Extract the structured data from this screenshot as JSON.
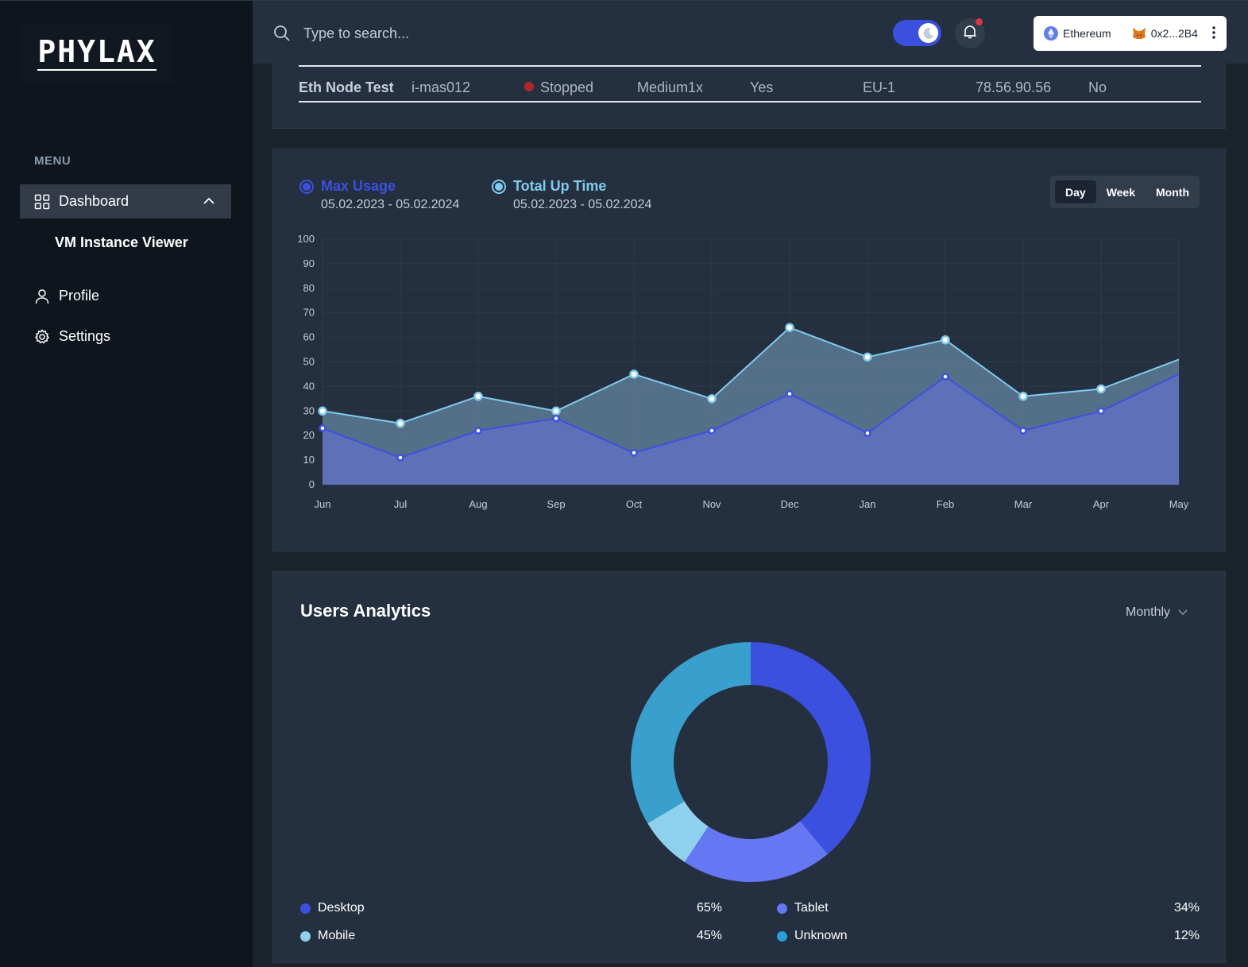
{
  "brand": {
    "logo_text": "PHYLAX"
  },
  "sidebar": {
    "menu_title": "MENU",
    "dashboard_label": "Dashboard",
    "sub_item_label": "VM Instance Viewer",
    "profile_label": "Profile",
    "settings_label": "Settings"
  },
  "header": {
    "search_placeholder": "Type to search...",
    "dark_mode_on": true,
    "network_label": "Ethereum",
    "account_label": "0x2...2B4"
  },
  "table_row": {
    "name": "Eth Node Test",
    "instance_id": "i-mas012",
    "status": "Stopped",
    "size": "Medium1x",
    "public": "Yes",
    "region": "EU-1",
    "ip": "78.56.90.56",
    "last": "No"
  },
  "usage_chart": {
    "series_a_label": "Max Usage",
    "series_a_dates": "05.02.2023 - 05.02.2024",
    "series_b_label": "Total Up Time",
    "series_b_dates": "05.02.2023 - 05.02.2024",
    "periods": [
      "Day",
      "Week",
      "Month"
    ],
    "active_period": "Day"
  },
  "chart_data": [
    {
      "type": "area",
      "categories": [
        "Jun",
        "Jul",
        "Aug",
        "Sep",
        "Oct",
        "Nov",
        "Dec",
        "Jan",
        "Feb",
        "Mar",
        "Apr",
        "May"
      ],
      "series": [
        {
          "name": "Max Usage",
          "color": "#3C50E0",
          "values": [
            23,
            11,
            22,
            27,
            13,
            22,
            37,
            21,
            44,
            22,
            30,
            45
          ]
        },
        {
          "name": "Total Up Time",
          "color": "#80CAEE",
          "values": [
            30,
            25,
            36,
            30,
            45,
            35,
            64,
            52,
            59,
            36,
            39,
            51
          ]
        }
      ],
      "ylim": [
        0,
        100
      ],
      "yticks": [
        0,
        10,
        20,
        30,
        40,
        50,
        60,
        70,
        80,
        90,
        100
      ],
      "grid": true
    },
    {
      "type": "pie",
      "title": "Users Analytics",
      "labels": [
        "Desktop",
        "Tablet",
        "Mobile",
        "Unknown"
      ],
      "values": [
        65,
        34,
        12,
        56
      ],
      "colors": [
        "#3C50E0",
        "#6577F3",
        "#8FD0EF",
        "#0FADCF"
      ]
    }
  ],
  "analytics": {
    "title": "Users Analytics",
    "period": "Monthly",
    "legend": [
      {
        "name": "Desktop",
        "pct": "65%",
        "color": "#3C50E0"
      },
      {
        "name": "Tablet",
        "pct": "34%",
        "color": "#6577F3"
      },
      {
        "name": "Mobile",
        "pct": "45%",
        "color": "#8FD0EF"
      },
      {
        "name": "Unknown",
        "pct": "12%",
        "color": "#2A9ED8"
      }
    ]
  }
}
